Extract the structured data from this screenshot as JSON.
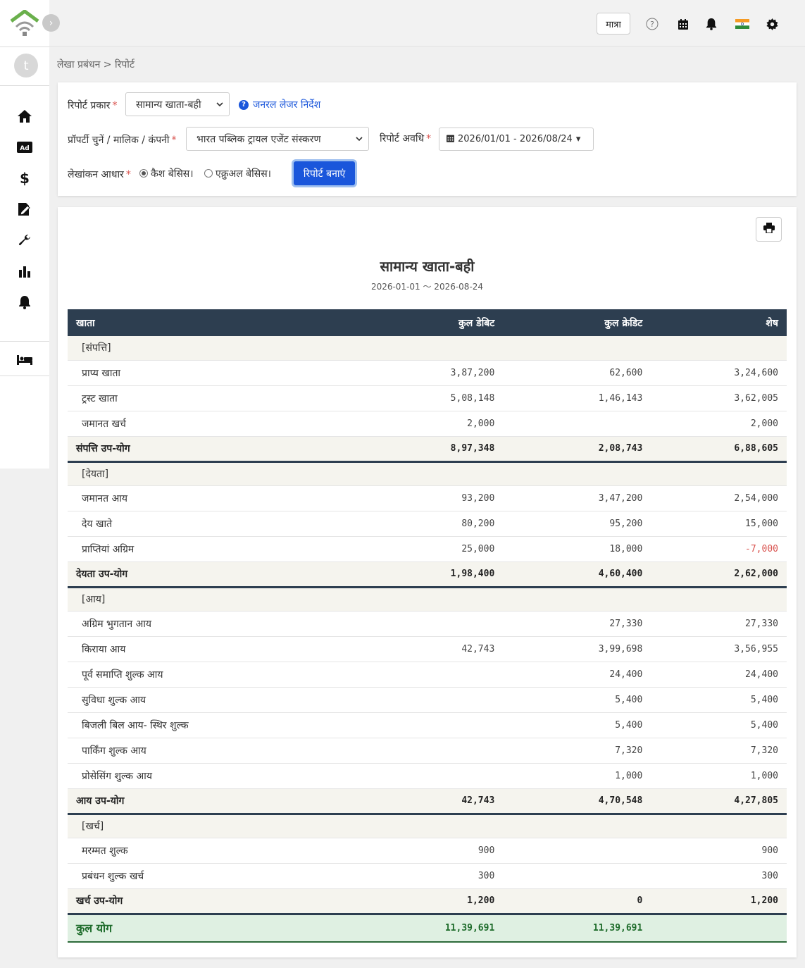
{
  "header": {
    "unit_label": "मात्रा",
    "icons": [
      "help-icon",
      "calendar-icon",
      "bell-icon",
      "india-flag-icon",
      "gear-icon"
    ]
  },
  "sidebar": {
    "avatar_letter": "t",
    "icons": [
      "home-icon",
      "ad-icon",
      "dollar-icon",
      "edit-document-icon",
      "wrench-icon",
      "bar-chart-icon",
      "bell-icon",
      "bed-icon"
    ]
  },
  "breadcrumb": "लेखा प्रबंधन > रिपोर्ट",
  "filters": {
    "report_type_label": "रिपोर्ट प्रकार",
    "report_type_value": "सामान्य खाता-बही",
    "help_link": "जनरल लेजर निर्देश",
    "property_label": "प्रॉपर्टी चुनें / मालिक / कंपनी",
    "property_value": "भारत पब्लिक ट्रायल एजेंट संस्करण",
    "period_label": "रिपोर्ट अवधि",
    "period_value": "2026/01/01 - 2026/08/24",
    "basis_label": "लेखांकन आधार",
    "basis_options": [
      "कैश बेसिस।",
      "एक्रुअल बेसिस।"
    ],
    "basis_selected": 0,
    "generate_button": "रिपोर्ट बनाएं"
  },
  "report": {
    "title": "सामान्य खाता-बही",
    "range": "2026-01-01 〜 2026-08-24",
    "columns": [
      "खाता",
      "कुल  डेबिट",
      "कुल  क्रेडिट",
      "शेष"
    ],
    "sections": [
      {
        "heading": "[संपत्ति]",
        "rows": [
          {
            "name": "प्राप्य खाता",
            "debit": "3,87,200",
            "credit": "62,600",
            "balance": "3,24,600"
          },
          {
            "name": "ट्रस्ट खाता",
            "debit": "5,08,148",
            "credit": "1,46,143",
            "balance": "3,62,005"
          },
          {
            "name": "जमानत खर्च",
            "debit": "2,000",
            "credit": "",
            "balance": "2,000"
          }
        ],
        "subtotal": {
          "name": "संपत्ति उप-योग",
          "debit": "8,97,348",
          "credit": "2,08,743",
          "balance": "6,88,605"
        }
      },
      {
        "heading": "[देयता]",
        "rows": [
          {
            "name": "जमानत आय",
            "debit": "93,200",
            "credit": "3,47,200",
            "balance": "2,54,000"
          },
          {
            "name": "देय खाते",
            "debit": "80,200",
            "credit": "95,200",
            "balance": "15,000"
          },
          {
            "name": "प्राप्तियां अग्रिम",
            "debit": "25,000",
            "credit": "18,000",
            "balance": "-7,000",
            "negative": true
          }
        ],
        "subtotal": {
          "name": "देयता उप-योग",
          "debit": "1,98,400",
          "credit": "4,60,400",
          "balance": "2,62,000"
        }
      },
      {
        "heading": "[आय]",
        "rows": [
          {
            "name": "अग्रिम भुगतान आय",
            "debit": "",
            "credit": "27,330",
            "balance": "27,330"
          },
          {
            "name": "किराया आय",
            "debit": "42,743",
            "credit": "3,99,698",
            "balance": "3,56,955"
          },
          {
            "name": "पूर्व समाप्ति शुल्क आय",
            "debit": "",
            "credit": "24,400",
            "balance": "24,400"
          },
          {
            "name": "सुविधा शुल्क आय",
            "debit": "",
            "credit": "5,400",
            "balance": "5,400"
          },
          {
            "name": "बिजली बिल आय- स्थिर शुल्क",
            "debit": "",
            "credit": "5,400",
            "balance": "5,400"
          },
          {
            "name": "पार्किंग शुल्क आय",
            "debit": "",
            "credit": "7,320",
            "balance": "7,320"
          },
          {
            "name": "प्रोसेसिंग शुल्क आय",
            "debit": "",
            "credit": "1,000",
            "balance": "1,000"
          }
        ],
        "subtotal": {
          "name": "आय उप-योग",
          "debit": "42,743",
          "credit": "4,70,548",
          "balance": "4,27,805"
        }
      },
      {
        "heading": "[खर्च]",
        "rows": [
          {
            "name": "मरम्मत शुल्क",
            "debit": "900",
            "credit": "",
            "balance": "900"
          },
          {
            "name": "प्रबंधन शुल्क खर्च",
            "debit": "300",
            "credit": "",
            "balance": "300"
          }
        ],
        "subtotal": {
          "name": "खर्च उप-योग",
          "debit": "1,200",
          "credit": "0",
          "balance": "1,200"
        }
      }
    ],
    "grand_total": {
      "name": "कुल योग",
      "debit": "11,39,691",
      "credit": "11,39,691",
      "balance": ""
    }
  }
}
